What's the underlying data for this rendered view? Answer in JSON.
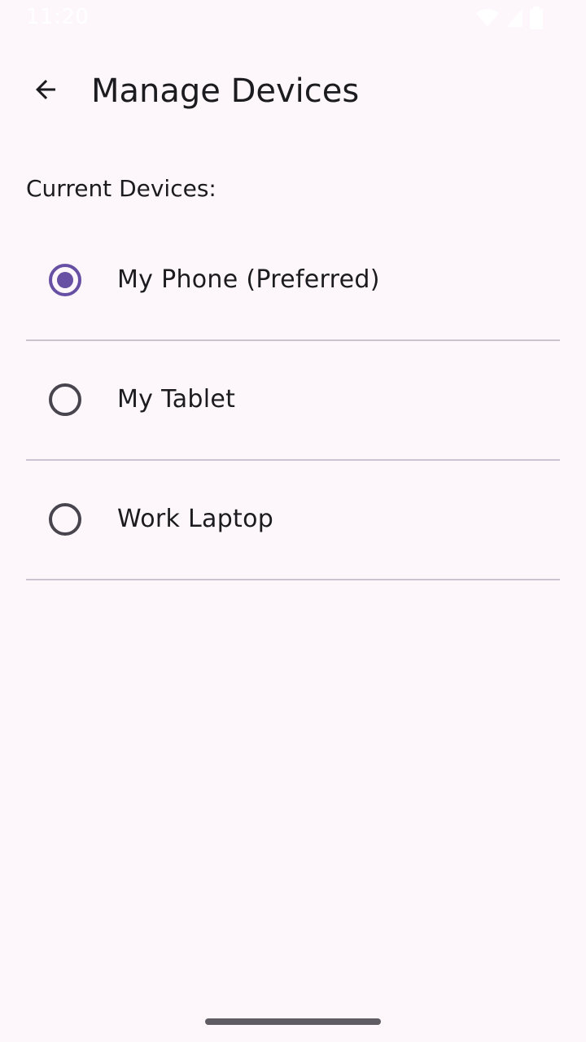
{
  "status_bar": {
    "time": "11:20",
    "icons": [
      "wifi-icon",
      "cellular-signal-icon",
      "battery-icon"
    ]
  },
  "app_bar": {
    "title": "Manage Devices",
    "back_icon": "arrow-back-icon"
  },
  "section": {
    "label": "Current Devices:"
  },
  "devices": [
    {
      "label": "My Phone (Preferred)",
      "selected": true
    },
    {
      "label": "My Tablet",
      "selected": false
    },
    {
      "label": "Work Laptop",
      "selected": false
    }
  ],
  "colors": {
    "background": "#FDF7FC",
    "accent": "#6750A4",
    "text": "#1C1B1F",
    "radio_unchecked": "#49454F",
    "divider": "#CAC4D0"
  }
}
